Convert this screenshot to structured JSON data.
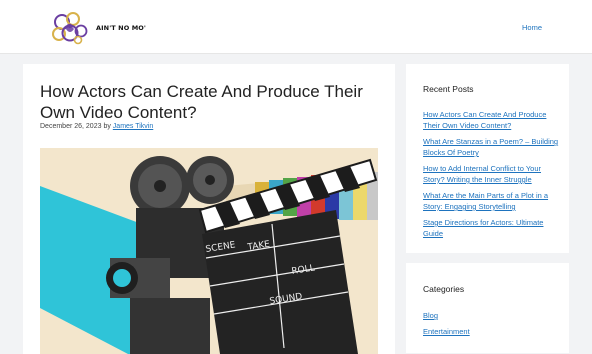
{
  "header": {
    "logo_text": "AIN'T NO MO'",
    "nav": [
      {
        "label": "Home"
      }
    ]
  },
  "post": {
    "title": "How Actors Can Create And Produce Their Own Video Content?",
    "date": "December 26, 2023",
    "by_text": "by",
    "author": "James Tikvin",
    "image": {
      "slate_words": [
        "SCENE",
        "TAKE",
        "ROLL",
        "SOUND"
      ]
    }
  },
  "sidebar": {
    "recent_posts": {
      "title": "Recent Posts",
      "items": [
        {
          "label": "How Actors Can Create And Produce Their Own Video Content?"
        },
        {
          "label": "What Are Stanzas in a Poem? – Building Blocks Of Poetry"
        },
        {
          "label": "How to Add Internal Conflict to Your Story? Writing the Inner Struggle"
        },
        {
          "label": "What Are the Main Parts of a Plot in a Story: Engaging Storytelling"
        },
        {
          "label": "Stage Directions for Actors: Ultimate Guide"
        }
      ]
    },
    "categories": {
      "title": "Categories",
      "items": [
        {
          "label": "Blog"
        },
        {
          "label": "Entertainment"
        }
      ]
    }
  },
  "colors": {
    "link": "#1e73be",
    "page_bg": "#f2f3f5",
    "logo_purple": "#6a3ea1",
    "logo_gold": "#d8b24a",
    "image_bg": "#f3e6cc",
    "image_cyan": "#2fc4d8"
  }
}
